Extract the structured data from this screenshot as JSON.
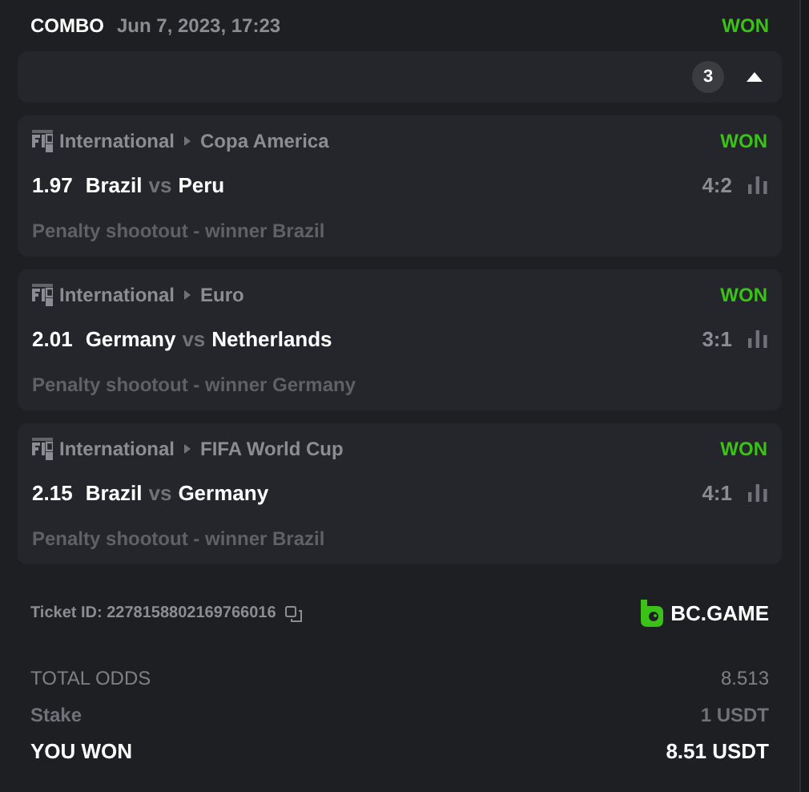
{
  "header": {
    "bet_type": "COMBO",
    "date": "Jun 7, 2023, 17:23",
    "status": "WON"
  },
  "selections_bar": {
    "count": "3",
    "expanded": true
  },
  "selections": [
    {
      "category": "International",
      "league": "Copa America",
      "status": "WON",
      "odds": "1.97",
      "home": "Brazil",
      "vs": "vs",
      "away": "Peru",
      "score": "4:2",
      "market": "Penalty shootout - winner Brazil"
    },
    {
      "category": "International",
      "league": "Euro",
      "status": "WON",
      "odds": "2.01",
      "home": "Germany",
      "vs": "vs",
      "away": "Netherlands",
      "score": "3:1",
      "market": "Penalty shootout - winner Germany"
    },
    {
      "category": "International",
      "league": "FIFA World Cup",
      "status": "WON",
      "odds": "2.15",
      "home": "Brazil",
      "vs": "vs",
      "away": "Germany",
      "score": "4:1",
      "market": "Penalty shootout - winner Brazil"
    }
  ],
  "ticket": {
    "label": "Ticket ID: 2278158802169766016",
    "brand": "BC.GAME"
  },
  "summary": [
    {
      "kind": "muted",
      "label": "TOTAL ODDS",
      "value": "8.513"
    },
    {
      "kind": "bold-muted",
      "label": "Stake",
      "value": "1 USDT"
    },
    {
      "kind": "highlight",
      "label": "YOU WON",
      "value": "8.51 USDT"
    }
  ]
}
